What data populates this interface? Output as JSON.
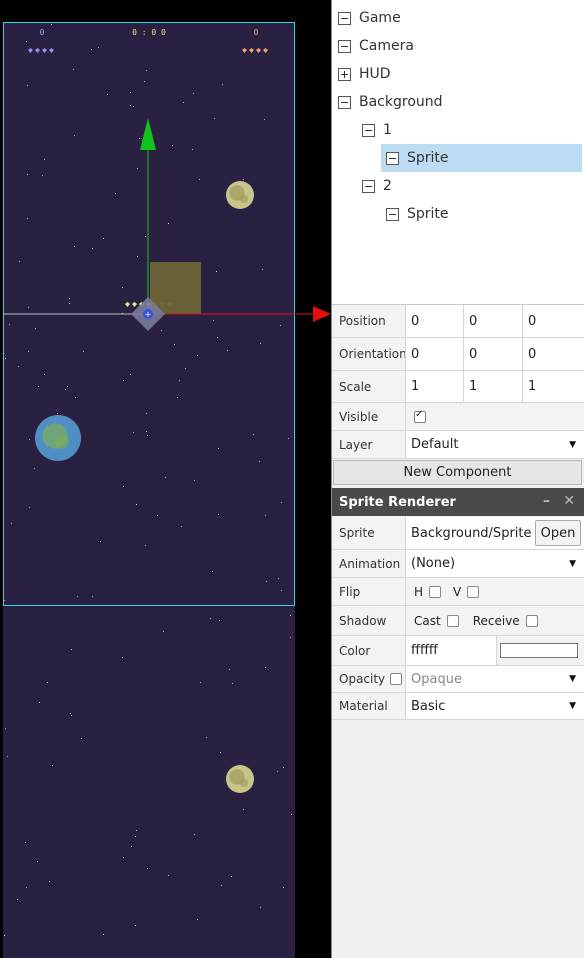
{
  "hud": {
    "score_left": "0",
    "score_center": "0 : 0 0",
    "score_right": "0"
  },
  "hierarchy": [
    {
      "label": "Game",
      "toggle": "minus"
    },
    {
      "label": "Camera",
      "toggle": "minus"
    },
    {
      "label": "HUD",
      "toggle": "plus"
    },
    {
      "label": "Background",
      "toggle": "minus"
    },
    {
      "label": "1",
      "toggle": "minus"
    },
    {
      "label": "Sprite",
      "toggle": "minus",
      "selected": true
    },
    {
      "label": "2",
      "toggle": "minus"
    },
    {
      "label": "Sprite",
      "toggle": "minus"
    }
  ],
  "transform": {
    "position_label": "Position",
    "position": [
      "0",
      "0",
      "0"
    ],
    "orientation_label": "Orientation",
    "orientation": [
      "0",
      "0",
      "0"
    ],
    "scale_label": "Scale",
    "scale": [
      "1",
      "1",
      "1"
    ],
    "visible_label": "Visible",
    "visible": true,
    "layer_label": "Layer",
    "layer": "Default"
  },
  "new_component_label": "New Component",
  "sprite_renderer": {
    "title": "Sprite Renderer",
    "minimize_icon": "minimize-icon",
    "close_icon": "close-icon",
    "sprite_label": "Sprite",
    "sprite_value": "Background/Sprite",
    "open_label": "Open",
    "animation_label": "Animation",
    "animation_value": "(None)",
    "flip_label": "Flip",
    "flip_h_label": "H",
    "flip_v_label": "V",
    "shadow_label": "Shadow",
    "cast_label": "Cast",
    "receive_label": "Receive",
    "color_label": "Color",
    "color_value": "ffffff",
    "opacity_label": "Opacity",
    "opacity_placeholder": "Opaque",
    "material_label": "Material",
    "material_value": "Basic"
  },
  "colors": {
    "scene_bg": "#2a2042",
    "view_frame": "#2fd7e8",
    "selection": "#bcdcf3",
    "gizmo_x": "#e01010",
    "gizmo_y": "#12c41a"
  }
}
